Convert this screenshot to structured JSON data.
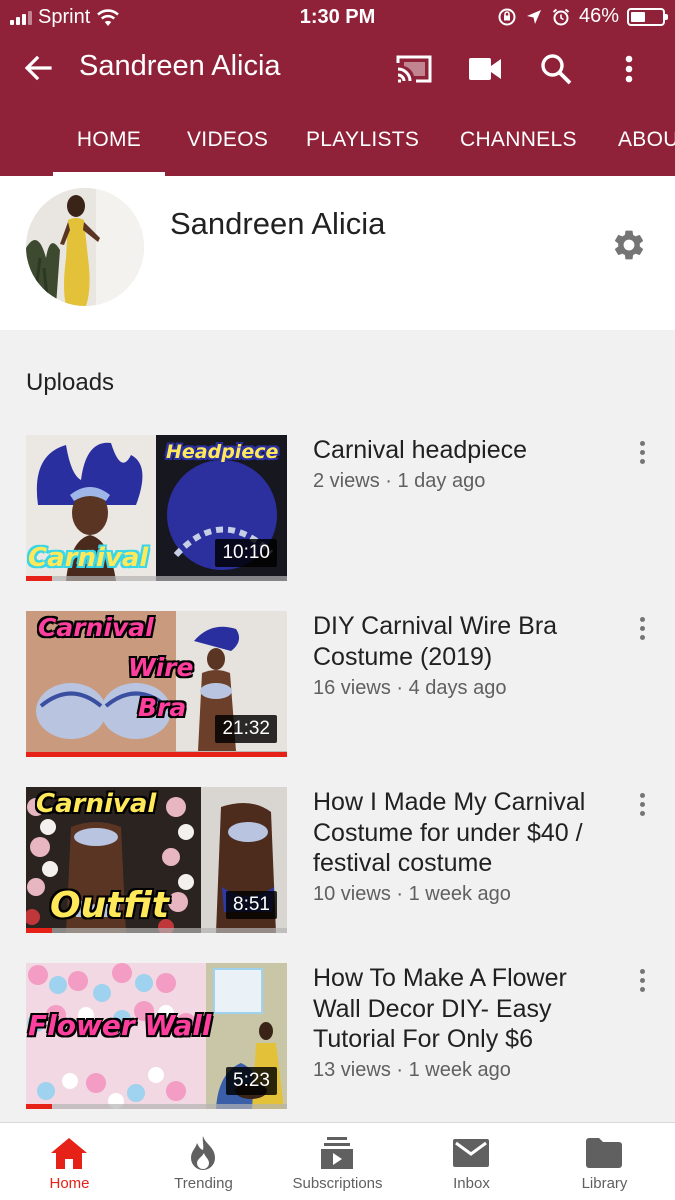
{
  "status_bar": {
    "carrier": "Sprint",
    "time": "1:30 PM",
    "battery_text": "46%",
    "battery_level": 0.46
  },
  "app_bar": {
    "title": "Sandreen Alicia",
    "icons": [
      "back-arrow-icon",
      "cast-icon",
      "video-camera-icon",
      "search-icon",
      "more-vert-icon"
    ]
  },
  "tabs": [
    {
      "label": "HOME",
      "active": true
    },
    {
      "label": "VIDEOS",
      "active": false
    },
    {
      "label": "PLAYLISTS",
      "active": false
    },
    {
      "label": "CHANNELS",
      "active": false
    },
    {
      "label": "ABOU",
      "active": false
    }
  ],
  "channel": {
    "name": "Sandreen Alicia"
  },
  "uploads": {
    "section_title": "Uploads",
    "videos": [
      {
        "title": "Carnival headpiece",
        "views": "2 views",
        "age": "1 day ago",
        "duration": "10:10",
        "watched_fraction": 0.1,
        "thumb_text": [
          "Headpiece",
          "Carnival"
        ]
      },
      {
        "title": "DIY Carnival Wire Bra Costume (2019)",
        "views": "16 views",
        "age": "4 days ago",
        "duration": "21:32",
        "watched_fraction": 1.0,
        "thumb_text": [
          "Carnival",
          "Wire",
          "Bra"
        ]
      },
      {
        "title": "How I Made My Carnival Costume for under $40 / festival costume",
        "views": "10 views",
        "age": "1 week ago",
        "duration": "8:51",
        "watched_fraction": 0.1,
        "thumb_text": [
          "Carnival",
          "Outfit"
        ]
      },
      {
        "title": "How To Make A Flower Wall Decor DIY- Easy Tutorial For Only $6",
        "views": "13 views",
        "age": "1 week ago",
        "duration": "5:23",
        "watched_fraction": 0.1,
        "thumb_text": [
          "Flower Wall"
        ]
      }
    ]
  },
  "bottom_nav": [
    {
      "label": "Home",
      "icon": "home-icon",
      "active": true
    },
    {
      "label": "Trending",
      "icon": "flame-icon",
      "active": false
    },
    {
      "label": "Subscriptions",
      "icon": "subscriptions-icon",
      "active": false
    },
    {
      "label": "Inbox",
      "icon": "mail-icon",
      "active": false
    },
    {
      "label": "Library",
      "icon": "folder-icon",
      "active": false
    }
  ],
  "colors": {
    "brand_bar": "#8f2239",
    "accent_red": "#e62117",
    "nav_inactive": "#606060"
  }
}
